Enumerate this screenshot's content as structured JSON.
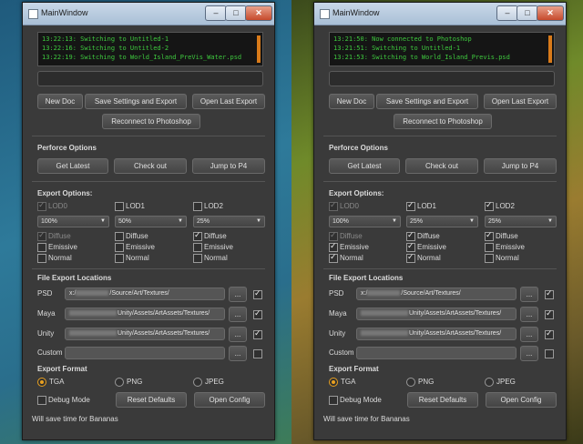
{
  "windows": [
    {
      "title": "MainWindow",
      "log_lines": [
        "13:22:13: Switching to Untitled-1",
        "13:22:16: Switching to Untitled-2",
        "13:22:19: Switching to World_Island_PreVis_Water.psd"
      ],
      "buttons": {
        "new_doc": "New Doc",
        "save_export": "Save Settings and Export",
        "open_last_export": "Open Last Export",
        "reconnect": "Reconnect to Photoshop"
      },
      "perforce": {
        "heading": "Perforce Options",
        "get_latest": "Get Latest",
        "check_out": "Check out",
        "jump_to_p4": "Jump to P4"
      },
      "export": {
        "heading": "Export Options:",
        "lods": [
          {
            "label": "LOD0",
            "checked": true,
            "disabled": true,
            "percent": "100%",
            "diffuse": true,
            "diffuse_disabled": true,
            "emissive": false,
            "normal": false
          },
          {
            "label": "LOD1",
            "checked": false,
            "disabled": false,
            "percent": "50%",
            "diffuse": false,
            "diffuse_disabled": false,
            "emissive": false,
            "normal": false
          },
          {
            "label": "LOD2",
            "checked": false,
            "disabled": false,
            "percent": "25%",
            "diffuse": true,
            "diffuse_disabled": false,
            "emissive": false,
            "normal": false
          }
        ],
        "diffuse_label": "Diffuse",
        "emissive_label": "Emissive",
        "normal_label": "Normal"
      },
      "locations": {
        "heading": "File Export Locations",
        "rows": [
          {
            "label": "PSD",
            "prefix": "x:/",
            "suffix": "/Source/Art/Textures/",
            "checked": true
          },
          {
            "label": "Maya",
            "prefix": "",
            "suffix": "Unity/Assets/ArtAssets/Textures/",
            "checked": true
          },
          {
            "label": "Unity",
            "prefix": "",
            "suffix": "Unity/Assets/ArtAssets/Textures/",
            "checked": true
          },
          {
            "label": "Custom",
            "prefix": "",
            "suffix": "",
            "checked": false
          }
        ],
        "browse": "..."
      },
      "format": {
        "heading": "Export Format",
        "options": [
          "TGA",
          "PNG",
          "JPEG"
        ],
        "selected": "TGA"
      },
      "debug_mode": "Debug Mode",
      "reset_defaults": "Reset Defaults",
      "open_config": "Open Config",
      "status": "Will save time for Bananas"
    },
    {
      "title": "MainWindow",
      "log_lines": [
        "13:21:50: Now connected to Photoshop",
        "13:21:51: Switching to Untitled-1",
        "13:21:53: Switching to World_Island_Previs.psd"
      ],
      "buttons": {
        "new_doc": "New Doc",
        "save_export": "Save Settings and Export",
        "open_last_export": "Open Last Export",
        "reconnect": "Reconnect to Photoshop"
      },
      "perforce": {
        "heading": "Perforce Options",
        "get_latest": "Get Latest",
        "check_out": "Check out",
        "jump_to_p4": "Jump to P4"
      },
      "export": {
        "heading": "Export Options:",
        "lods": [
          {
            "label": "LOD0",
            "checked": true,
            "disabled": true,
            "percent": "100%",
            "diffuse": true,
            "diffuse_disabled": true,
            "emissive": true,
            "normal": true
          },
          {
            "label": "LOD1",
            "checked": true,
            "disabled": false,
            "percent": "25%",
            "diffuse": true,
            "diffuse_disabled": false,
            "emissive": true,
            "normal": true
          },
          {
            "label": "LOD2",
            "checked": true,
            "disabled": false,
            "percent": "25%",
            "diffuse": true,
            "diffuse_disabled": false,
            "emissive": false,
            "normal": false
          }
        ],
        "diffuse_label": "Diffuse",
        "emissive_label": "Emissive",
        "normal_label": "Normal"
      },
      "locations": {
        "heading": "File Export Locations",
        "rows": [
          {
            "label": "PSD",
            "prefix": "x:/",
            "suffix": "/Source/Art/Textures/",
            "checked": true
          },
          {
            "label": "Maya",
            "prefix": "",
            "suffix": "Unity/Assets/ArtAssets/Textures/",
            "checked": true
          },
          {
            "label": "Unity",
            "prefix": "",
            "suffix": "Unity/Assets/ArtAssets/Textures/",
            "checked": true
          },
          {
            "label": "Custom",
            "prefix": "",
            "suffix": "",
            "checked": false
          }
        ],
        "browse": "..."
      },
      "format": {
        "heading": "Export Format",
        "options": [
          "TGA",
          "PNG",
          "JPEG"
        ],
        "selected": "TGA"
      },
      "debug_mode": "Debug Mode",
      "reset_defaults": "Reset Defaults",
      "open_config": "Open Config",
      "status": "Will save time for Bananas"
    }
  ],
  "colors": {
    "log_text": "#3ec83e",
    "accent_radio": "#e8a020",
    "window_bg": "#3a3a3a"
  }
}
